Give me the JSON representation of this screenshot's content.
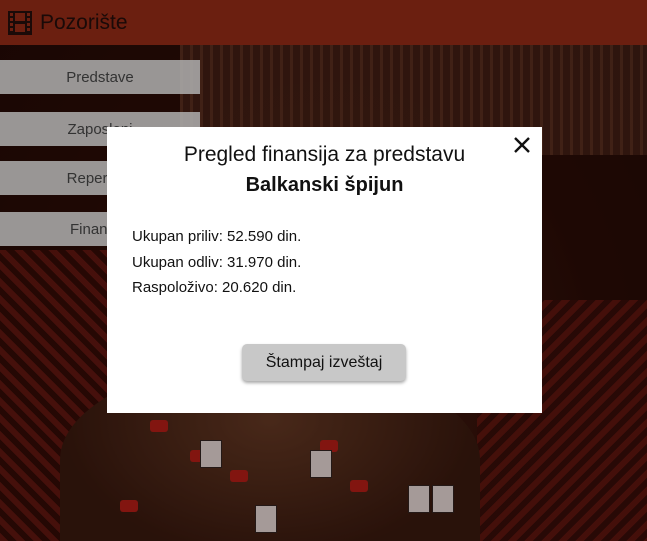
{
  "app": {
    "title": "Pozorište",
    "logo_icon": "film-strip-icon"
  },
  "colors": {
    "header_bg": "#6b1f10",
    "sidebar_item_bg": "#afafaf",
    "modal_bg": "#ffffff",
    "button_bg": "#c8c8c8"
  },
  "sidebar": {
    "items": [
      {
        "label": "Predstave"
      },
      {
        "label": "Zaposleni"
      },
      {
        "label": "Repertoar"
      },
      {
        "label": "Finansije"
      }
    ]
  },
  "modal": {
    "title": "Pregled finansija za predstavu",
    "subtitle": "Balkanski špijun",
    "close_icon": "close-icon",
    "stats": [
      {
        "text": "Ukupan priliv: 52.590 din."
      },
      {
        "text": "Ukupan odliv: 31.970 din."
      },
      {
        "text": "Raspoloživo: 20.620 din."
      }
    ],
    "print_button": "Štampaj izveštaj"
  }
}
